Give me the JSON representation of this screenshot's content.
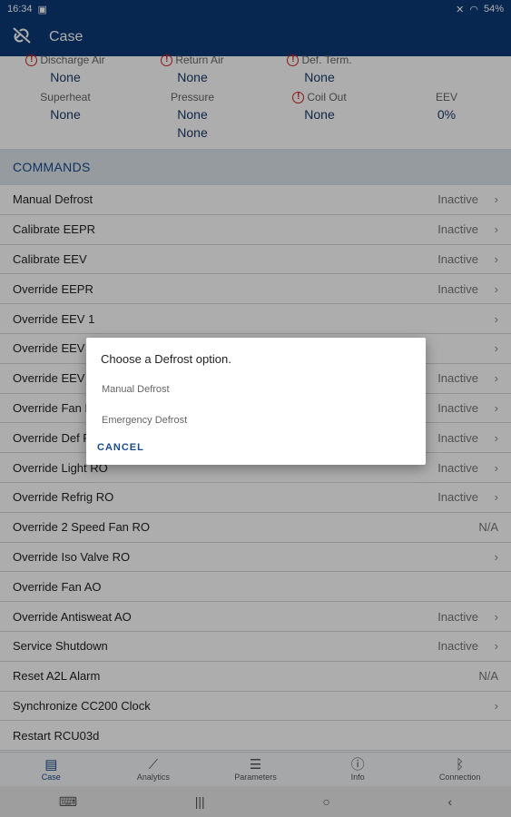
{
  "status_bar": {
    "time": "16:34",
    "battery": "54%"
  },
  "app_bar": {
    "title": "Case"
  },
  "sensors": [
    {
      "label": "Discharge Air",
      "value": "None",
      "alarm": true
    },
    {
      "label": "Return Air",
      "value": "None",
      "alarm": true
    },
    {
      "label": "Def. Term.",
      "value": "None",
      "alarm": true
    },
    {
      "label": "Superheat",
      "value": "None",
      "alarm": false
    },
    {
      "label": "Pressure",
      "value": "None",
      "value2": "None",
      "alarm": false
    },
    {
      "label": "Coil Out",
      "value": "None",
      "alarm": true
    },
    {
      "label": "EEV",
      "value": "0%",
      "alarm": false
    }
  ],
  "commands_header": "COMMANDS",
  "commands": [
    {
      "label": "Manual Defrost",
      "status": "Inactive",
      "chevron": true
    },
    {
      "label": "Calibrate EEPR",
      "status": "Inactive",
      "chevron": true
    },
    {
      "label": "Calibrate EEV",
      "status": "Inactive",
      "chevron": true
    },
    {
      "label": "Override EEPR",
      "status": "Inactive",
      "chevron": true
    },
    {
      "label": "Override EEV 1",
      "status": "",
      "chevron": true
    },
    {
      "label": "Override EEV",
      "status": "",
      "chevron": true
    },
    {
      "label": "Override EEV",
      "status": "Inactive",
      "chevron": true
    },
    {
      "label": "Override Fan R",
      "status": "Inactive",
      "chevron": true
    },
    {
      "label": "Override Def R",
      "status": "Inactive",
      "chevron": true
    },
    {
      "label": "Override Light RO",
      "status": "Inactive",
      "chevron": true
    },
    {
      "label": "Override Refrig RO",
      "status": "Inactive",
      "chevron": true
    },
    {
      "label": "Override 2 Speed Fan RO",
      "status": "N/A",
      "chevron": false
    },
    {
      "label": "Override Iso Valve RO",
      "status": "",
      "chevron": true
    },
    {
      "label": "Override Fan AO",
      "status": "",
      "chevron": false
    },
    {
      "label": "Override Antisweat AO",
      "status": "Inactive",
      "chevron": true
    },
    {
      "label": "Service Shutdown",
      "status": "Inactive",
      "chevron": true
    },
    {
      "label": "Reset A2L Alarm",
      "status": "N/A",
      "chevron": false
    },
    {
      "label": "Synchronize CC200 Clock",
      "status": "",
      "chevron": true
    },
    {
      "label": "Restart RCU03d",
      "status": "",
      "chevron": false
    }
  ],
  "bottom_nav": [
    {
      "label": "Case",
      "icon": "case-icon",
      "active": true
    },
    {
      "label": "Analytics",
      "icon": "chart-icon",
      "active": false
    },
    {
      "label": "Parameters",
      "icon": "sliders-icon",
      "active": false
    },
    {
      "label": "Info",
      "icon": "info-icon",
      "active": false
    },
    {
      "label": "Connection",
      "icon": "bluetooth-icon",
      "active": false
    }
  ],
  "dialog": {
    "title": "Choose a Defrost option.",
    "options": [
      "Manual Defrost",
      "Emergency Defrost"
    ],
    "cancel": "CANCEL"
  }
}
